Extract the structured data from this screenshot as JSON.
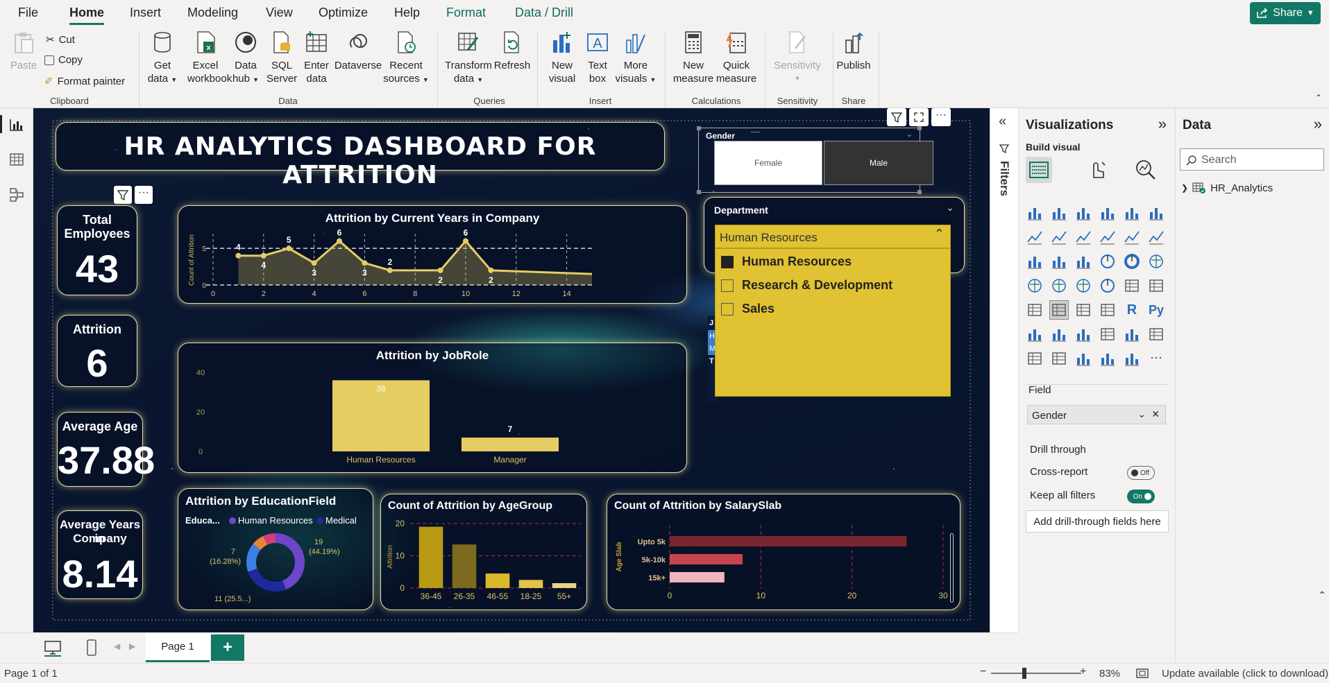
{
  "menu": {
    "items": [
      "File",
      "Home",
      "Insert",
      "Modeling",
      "View",
      "Optimize",
      "Help",
      "Format",
      "Data / Drill"
    ],
    "share": "Share"
  },
  "ribbon": {
    "clipboard": {
      "paste": "Paste",
      "cut": "Cut",
      "copy": "Copy",
      "format_painter": "Format painter",
      "group": "Clipboard"
    },
    "data": {
      "get_data": [
        "Get",
        "data"
      ],
      "excel": [
        "Excel",
        "workbook"
      ],
      "data_hub": [
        "Data",
        "hub"
      ],
      "sql": [
        "SQL",
        "Server"
      ],
      "enter": [
        "Enter",
        "data"
      ],
      "dataverse": "Dataverse",
      "recent": [
        "Recent",
        "sources"
      ],
      "group": "Data"
    },
    "queries": {
      "transform": [
        "Transform",
        "data"
      ],
      "refresh": "Refresh",
      "group": "Queries"
    },
    "insert": {
      "new_visual": [
        "New",
        "visual"
      ],
      "text_box": [
        "Text",
        "box"
      ],
      "more_visuals": [
        "More",
        "visuals"
      ],
      "group": "Insert"
    },
    "calculations": {
      "new_measure": [
        "New",
        "measure"
      ],
      "quick_measure": [
        "Quick",
        "measure"
      ],
      "group": "Calculations"
    },
    "sensitivity": {
      "label": "Sensitivity",
      "group": "Sensitivity"
    },
    "share": {
      "publish": "Publish",
      "group": "Share"
    }
  },
  "dashboard": {
    "title": "HR ANALYTICS DASHBOARD FOR ATTRITION",
    "kpis": [
      {
        "label": [
          "Total",
          "Employees"
        ],
        "value": "43"
      },
      {
        "label": [
          "Attrition"
        ],
        "value": "6"
      },
      {
        "label": [
          "Average Age"
        ],
        "value": "37.88"
      },
      {
        "label": [
          "Average Years in",
          "Company"
        ],
        "value": "8.14"
      }
    ],
    "gender_slicer": {
      "title": "Gender",
      "options": [
        "Female",
        "Male"
      ],
      "selected": "Male"
    },
    "department_slicer": {
      "title": "Department",
      "selected": "Human Resources",
      "options": [
        "Human Resources",
        "Research & Development",
        "Sales"
      ],
      "checked": [
        true,
        false,
        false
      ]
    },
    "behind_labels": [
      "J",
      "H",
      "M",
      "T"
    ]
  },
  "chart_data": [
    {
      "type": "line",
      "title": "Attrition by Current Years in Company",
      "ylabel": "Count of Attrition",
      "xlabel": "",
      "x": [
        1,
        2,
        3,
        4,
        5,
        6,
        7,
        9,
        10,
        11,
        15
      ],
      "y": [
        4,
        4,
        5,
        3,
        6,
        3,
        2,
        2,
        6,
        2,
        1.5
      ],
      "data_labels": [
        {
          "x": 1,
          "label": "4"
        },
        {
          "x": 2,
          "label": "4"
        },
        {
          "x": 3,
          "label": "5"
        },
        {
          "x": 4,
          "label": "3"
        },
        {
          "x": 5,
          "label": "6"
        },
        {
          "x": 6,
          "label": "3"
        },
        {
          "x": 7,
          "label": "2"
        },
        {
          "x": 9,
          "label": "2"
        },
        {
          "x": 10,
          "label": "6"
        },
        {
          "x": 11,
          "label": "2"
        }
      ],
      "xticks": [
        0,
        2,
        4,
        6,
        8,
        10,
        12,
        14
      ],
      "xlim": [
        0,
        15
      ],
      "ylim": [
        0,
        7
      ],
      "reference_line": 5,
      "reference_label": "5",
      "zero_label": "0",
      "color": "#e6cd62"
    },
    {
      "type": "bar",
      "title": "Attrition by JobRole",
      "categories": [
        "Human Resources",
        "Manager"
      ],
      "values": [
        36,
        7
      ],
      "ylim": [
        0,
        40
      ],
      "yticks": [
        0,
        20,
        40
      ],
      "color": "#e6cd62"
    },
    {
      "type": "pie",
      "title": "Attrition by EducationField",
      "legend_title": "Educa...",
      "legend": [
        "Human Resources",
        "Medical"
      ],
      "slices": [
        {
          "value": 19,
          "label": "19",
          "pct": "(44.19%)",
          "color": "#6f45c9"
        },
        {
          "value": 11,
          "label": "11 (25.5...)",
          "color": "#1c2a9c"
        },
        {
          "value": 7,
          "label": "7",
          "pct": "(16.28%)",
          "color": "#3b7fe4"
        },
        {
          "value": 3,
          "color": "#e8833a"
        },
        {
          "value": 3,
          "color": "#d23c7a"
        }
      ]
    },
    {
      "type": "bar",
      "title": "Count of Attrition by AgeGroup",
      "ylabel": "Attrition",
      "categories": [
        "36-45",
        "26-35",
        "46-55",
        "18-25",
        "55+"
      ],
      "values": [
        19,
        13.5,
        4.5,
        2.5,
        1.5
      ],
      "ylim": [
        0,
        20
      ],
      "yticks": [
        0,
        10,
        20
      ],
      "colors": [
        "#b99a13",
        "#7d6a1f",
        "#d9b92a",
        "#e2c448",
        "#ead489"
      ]
    },
    {
      "type": "bar",
      "orientation": "horizontal",
      "title": "Count of Attrition by SalarySlab",
      "ylabel": "Age Slab",
      "categories": [
        "Upto 5k",
        "5k-10k",
        "15k+"
      ],
      "values": [
        26,
        8,
        6
      ],
      "xlim": [
        0,
        30
      ],
      "xticks": [
        0,
        10,
        20,
        30
      ],
      "colors": [
        "#7a2630",
        "#c7444f",
        "#f0b6bf"
      ]
    }
  ],
  "panes": {
    "filters": "Filters",
    "visualizations": {
      "title": "Visualizations",
      "build": "Build visual",
      "field_label": "Field",
      "field_value": "Gender",
      "drill_through": "Drill through",
      "cross_report": "Cross-report",
      "cross_state": "Off",
      "keep_filters": "Keep all filters",
      "keep_state": "On",
      "add_fields": "Add drill-through fields here"
    },
    "data": {
      "title": "Data",
      "search_placeholder": "Search",
      "table": "HR_Analytics"
    }
  },
  "pages": {
    "current": "Page 1",
    "add": "+"
  },
  "status": {
    "page": "Page 1 of 1",
    "zoom": "83%",
    "update": "Update available (click to download)"
  },
  "colors": {
    "accent": "#117865",
    "slicer_yellow": "#e0c232",
    "card_border": "#e9e2b8"
  }
}
